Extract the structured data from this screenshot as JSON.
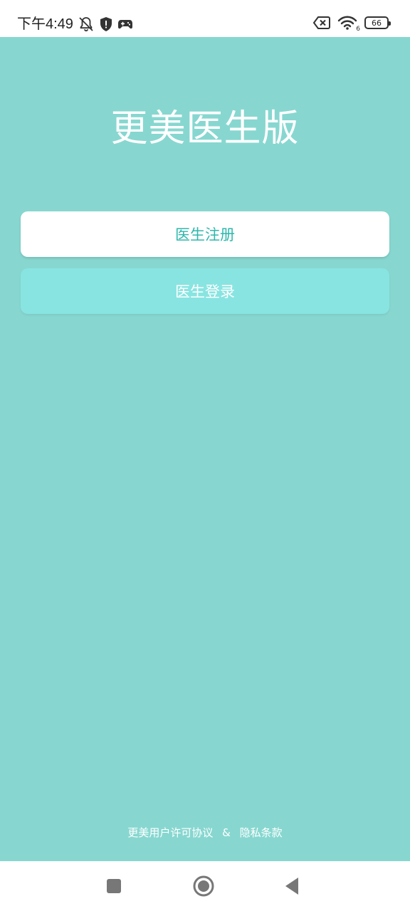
{
  "status_bar": {
    "time": "下午4:49",
    "icons_left": [
      "bell-off-icon",
      "shield-alert-icon",
      "gamepad-icon"
    ],
    "icons_right": [
      "sim-x-icon",
      "wifi-icon"
    ],
    "wifi_label": "6",
    "battery_level": "66"
  },
  "main": {
    "app_title": "更美医生版",
    "register_label": "医生注册",
    "login_label": "医生登录",
    "footer": {
      "license_label": "更美用户许可协议",
      "separator": "&",
      "privacy_label": "隐私条款"
    }
  },
  "nav_bar": {
    "icons": [
      "recent-apps-icon",
      "home-icon",
      "back-icon"
    ]
  },
  "colors": {
    "background": "#87d7d0",
    "register_bg": "#ffffff",
    "register_text": "#2fb8ad",
    "login_bg": "#88e4e1",
    "login_text": "#ffffff"
  }
}
